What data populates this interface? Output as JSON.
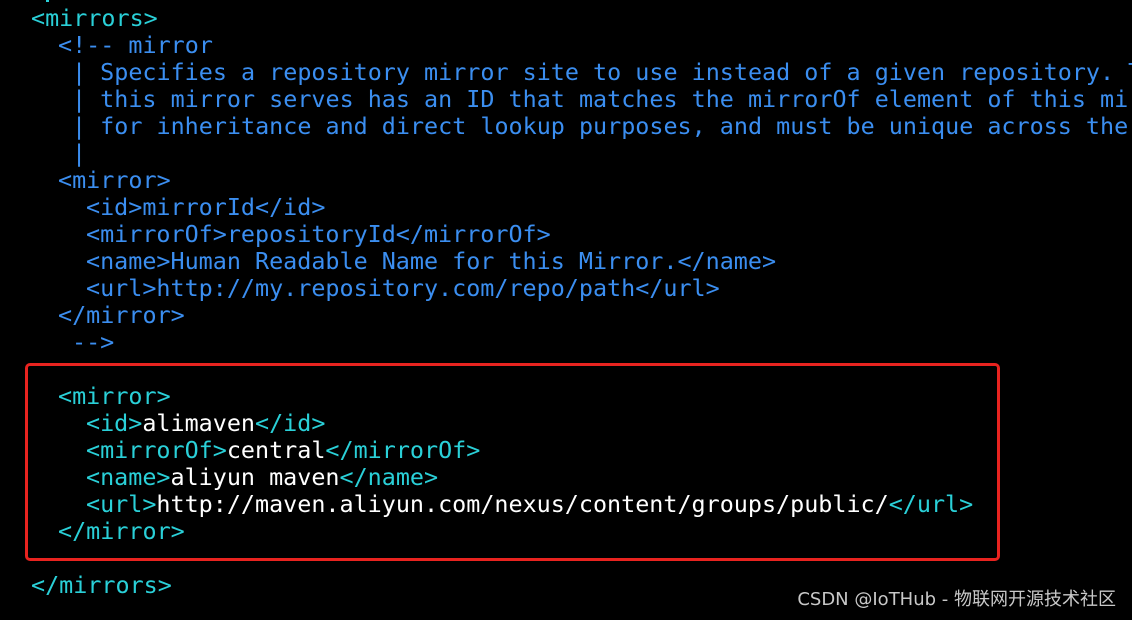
{
  "terminal": {
    "background_color": "#000000",
    "tag_color": "#2ad0d8",
    "comment_color": "#3b8ef0",
    "value_color": "#ffffff",
    "highlight_color": "#e8231f"
  },
  "mirrors_open": "<mirrors>",
  "comment": {
    "open": "<!-- mirror",
    "lines": [
      "| Specifies a repository mirror site to use instead of a given repository. T",
      "| this mirror serves has an ID that matches the mirrorOf element of this mir",
      "| for inheritance and direct lookup purposes, and must be unique across the",
      "|"
    ],
    "close": "-->"
  },
  "example_mirror": {
    "open": "<mirror>",
    "id": "<id>mirrorId</id>",
    "mirrorOf": "<mirrorOf>repositoryId</mirrorOf>",
    "name": "<name>Human Readable Name for this Mirror.</name>",
    "url": "<url>http://my.repository.com/repo/path</url>",
    "close": "</mirror>"
  },
  "aliyun_mirror": {
    "open": "<mirror>",
    "id_open": "<id>",
    "id_value": "alimaven",
    "id_close": "</id>",
    "mirrorOf_open": "<mirrorOf>",
    "mirrorOf_value": "central",
    "mirrorOf_close": "</mirrorOf>",
    "name_open": "<name>",
    "name_value": "aliyun maven",
    "name_close": "</name>",
    "url_open": "<url>",
    "url_value": "http://maven.aliyun.com/nexus/content/groups/public/",
    "url_close": "</url>",
    "close": "</mirror>"
  },
  "mirrors_close": "</mirrors>",
  "watermark": "CSDN @IoTHub - 物联网开源技术社区"
}
